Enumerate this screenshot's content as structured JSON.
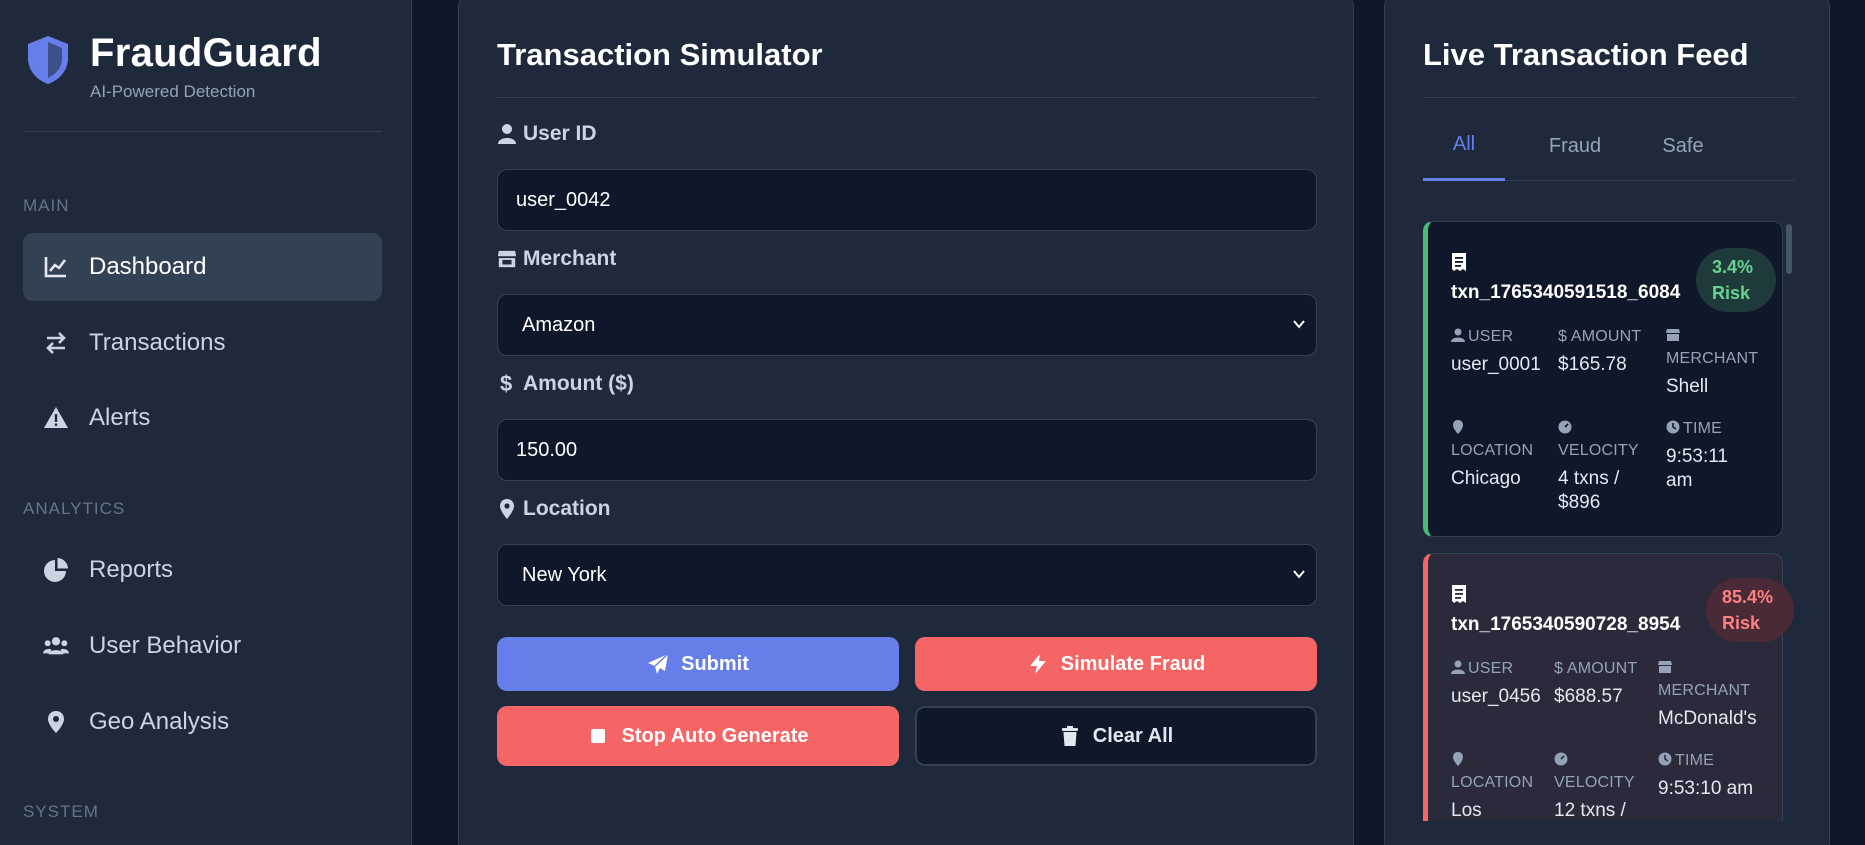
{
  "brand": {
    "name": "FraudGuard",
    "tagline": "AI-Powered Detection"
  },
  "sidebar": {
    "sections": [
      "MAIN",
      "ANALYTICS",
      "SYSTEM"
    ],
    "items": [
      {
        "label": "Dashboard",
        "icon": "chart-line-icon",
        "active": true
      },
      {
        "label": "Transactions",
        "icon": "exchange-icon"
      },
      {
        "label": "Alerts",
        "icon": "warning-icon"
      },
      {
        "label": "Reports",
        "icon": "pie-chart-icon"
      },
      {
        "label": "User Behavior",
        "icon": "users-icon"
      },
      {
        "label": "Geo Analysis",
        "icon": "map-pin-icon"
      }
    ]
  },
  "simulator": {
    "title": "Transaction Simulator",
    "user_id_label": "User ID",
    "user_id_value": "user_0042",
    "merchant_label": "Merchant",
    "merchant_value": "Amazon",
    "amount_label": "Amount ($)",
    "amount_value": "150.00",
    "location_label": "Location",
    "location_value": "New York",
    "submit_label": "Submit",
    "simulate_label": "Simulate Fraud",
    "stop_label": "Stop Auto Generate",
    "clear_label": "Clear All",
    "colors": {
      "primary": "#667eea",
      "danger": "#f56565"
    }
  },
  "feed": {
    "title": "Live Transaction Feed",
    "tabs": [
      "All",
      "Fraud",
      "Safe"
    ],
    "active_tab": "All",
    "labels": {
      "user": "USER",
      "amount": "AMOUNT",
      "merchant": "MERCHANT",
      "location": "LOCATION",
      "velocity": "VELOCITY",
      "time": "TIME"
    },
    "transactions": [
      {
        "id": "txn_1765340591518_6084",
        "risk_pct": "3.4%",
        "risk_word": "Risk",
        "status": "safe",
        "user": "user_0001",
        "amount": "$165.78",
        "merchant": "Shell",
        "location": "Chicago",
        "velocity_1": "4 txns /",
        "velocity_2": "$896",
        "time_1": "9:53:11",
        "time_2": "am"
      },
      {
        "id": "txn_1765340590728_8954",
        "risk_pct": "85.4%",
        "risk_word": "Risk",
        "status": "fraud",
        "user": "user_0456",
        "amount": "$688.57",
        "merchant": "McDonald's",
        "location": "Los",
        "velocity_1": "12 txns /",
        "time_1": "9:53:10 am"
      }
    ],
    "colors": {
      "safe": "#48bb78",
      "fraud": "#f56565"
    }
  }
}
